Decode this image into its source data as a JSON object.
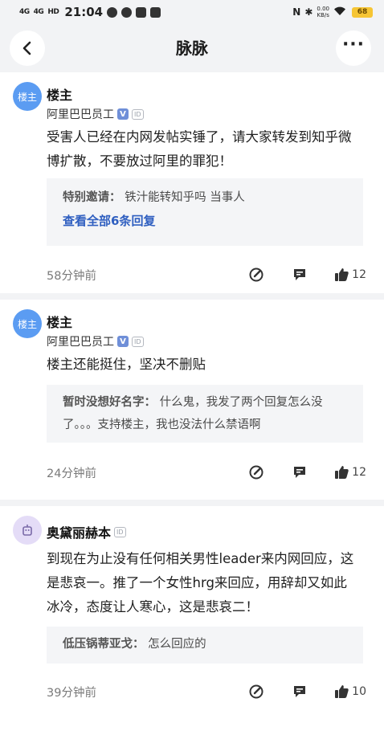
{
  "status_bar": {
    "signal_1": "4G",
    "signal_2": "4G",
    "hd": "HD",
    "time": "21:04",
    "net_speed_value": "0.00",
    "net_speed_unit": "KB/s",
    "battery": "68"
  },
  "header": {
    "title": "脉脉"
  },
  "posts": [
    {
      "avatar_text": "楼主",
      "username": "楼主",
      "company": "阿里巴巴员工",
      "content": "受害人已经在内网发帖实锤了，请大家转发到知乎微博扩散，不要放过阿里的罪犯！",
      "reply": {
        "name": "特别邀请：",
        "text": "铁汁能转知乎吗 当事人"
      },
      "view_all": "查看全部6条回复",
      "time": "58分钟前",
      "likes": "12"
    },
    {
      "avatar_text": "楼主",
      "username": "楼主",
      "company": "阿里巴巴员工",
      "content": "楼主还能挺住，坚决不删贴",
      "reply": {
        "name": "暂时没想好名字：",
        "text": "什么鬼，我发了两个回复怎么没了。。。支持楼主，我也没法什么禁语啊"
      },
      "time": "24分钟前",
      "likes": "12"
    },
    {
      "username": "奥黛丽赫本",
      "content": "到现在为止没有任何相关男性leader来内网回应，这是悲哀一。推了一个女性hrg来回应，用辞却又如此冰冷，态度让人寒心，这是悲哀二！",
      "reply": {
        "name": "低压锅蒂亚戈：",
        "text": "怎么回应的"
      },
      "time": "39分钟前",
      "likes": "10"
    }
  ],
  "badges": {
    "id": "ID",
    "verified": "V"
  },
  "icons": [
    "back-arrow-icon",
    "more-dots-icon",
    "edit-icon",
    "comment-icon",
    "thumbs-up-icon"
  ],
  "colors": {
    "link": "#2f5fc0",
    "avatar_blue": "#5b9cf2",
    "battery": "#f6c534",
    "background_gray": "#f2f3f5"
  }
}
